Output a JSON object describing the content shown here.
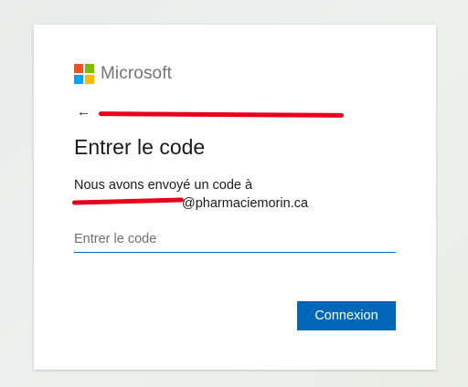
{
  "brand": {
    "name": "Microsoft",
    "logo_colors": [
      "#f25022",
      "#7fba00",
      "#00a4ef",
      "#ffb900"
    ]
  },
  "nav": {
    "back_icon": "arrow-left-icon",
    "back_glyph": "←"
  },
  "form": {
    "title": "Entrer le code",
    "description_line1": "Nous avons envoyé un code à",
    "email_visible_suffix": "@pharmaciemorin.ca",
    "code_input": {
      "placeholder": "Entrer le code",
      "value": ""
    },
    "submit_label": "Connexion"
  },
  "colors": {
    "accent": "#0067b8",
    "redaction": "#e8001c",
    "text": "#1b1b1b"
  }
}
